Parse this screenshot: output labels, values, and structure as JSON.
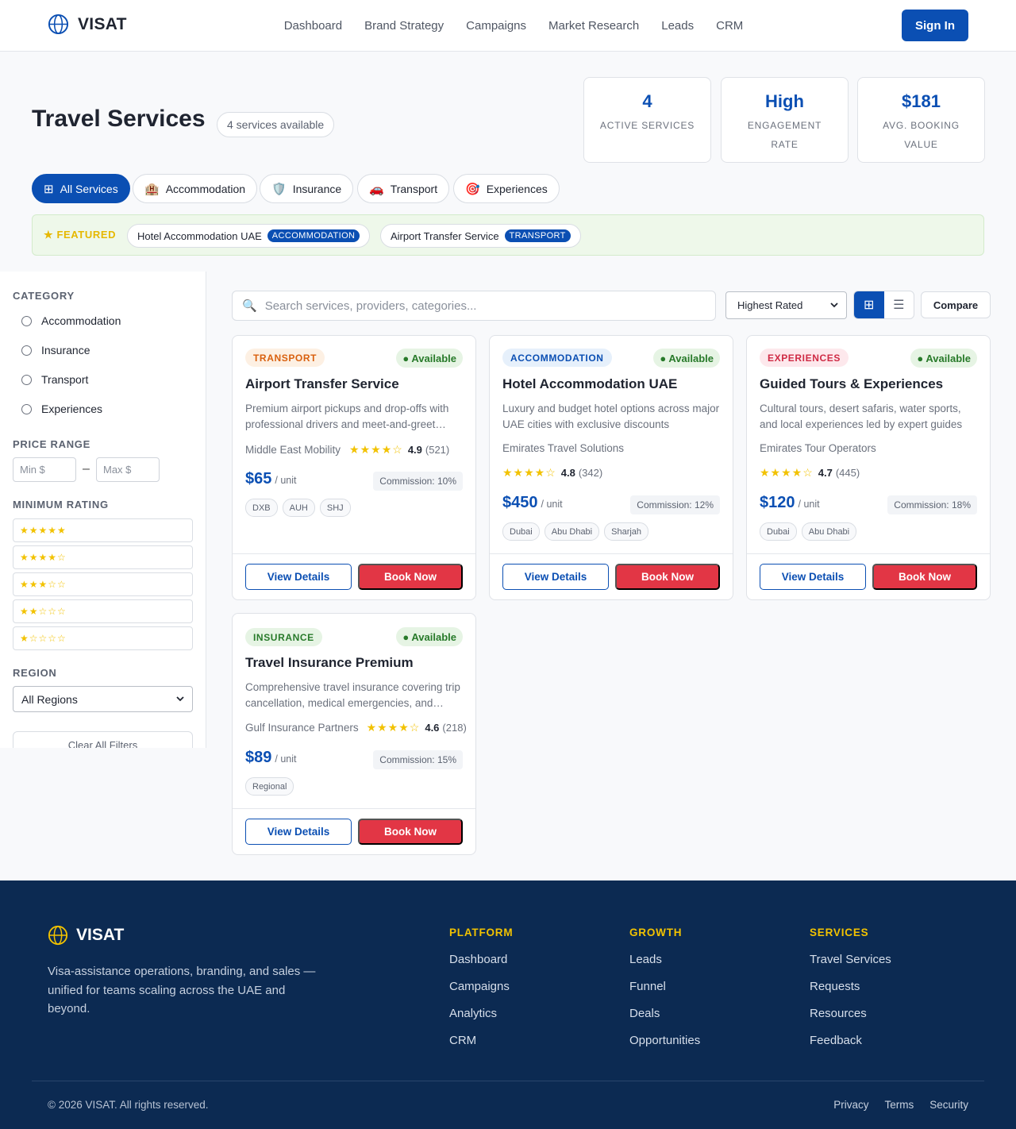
{
  "nav": {
    "brand": "VISAT",
    "links": [
      "Dashboard",
      "Brand Strategy",
      "Campaigns",
      "Market Research",
      "Leads",
      "CRM"
    ],
    "sign_in": "Sign In"
  },
  "header": {
    "title": "Travel Services",
    "count": "4 services available",
    "stats": [
      {
        "value": "4",
        "label": "ACTIVE SERVICES"
      },
      {
        "value": "High",
        "label": "ENGAGEMENT RATE"
      },
      {
        "value": "$181",
        "label": "AVG. BOOKING VALUE"
      }
    ]
  },
  "tabs": [
    {
      "icon": "grid-icon",
      "glyph": "⊞",
      "label": "All Services",
      "active": true
    },
    {
      "icon": "hotel-icon",
      "glyph": "🏨",
      "label": "Accommodation"
    },
    {
      "icon": "shield-icon",
      "glyph": "🛡️",
      "label": "Insurance"
    },
    {
      "icon": "car-icon",
      "glyph": "🚗",
      "label": "Transport"
    },
    {
      "icon": "target-icon",
      "glyph": "🎯",
      "label": "Experiences"
    }
  ],
  "featured": {
    "label": "★ FEATURED",
    "items": [
      {
        "name": "Hotel Accommodation UAE",
        "tag": "ACCOMMODATION"
      },
      {
        "name": "Airport Transfer Service",
        "tag": "TRANSPORT"
      }
    ]
  },
  "sidebar": {
    "category_heading": "CATEGORY",
    "categories": [
      "Accommodation",
      "Insurance",
      "Transport",
      "Experiences"
    ],
    "price_heading": "PRICE RANGE",
    "min_placeholder": "Min $",
    "max_placeholder": "Max $",
    "price_sep": "–",
    "rating_heading": "MINIMUM RATING",
    "ratings": [
      "★★★★★",
      "★★★★☆",
      "★★★☆☆",
      "★★☆☆☆",
      "★☆☆☆☆"
    ],
    "region_heading": "REGION",
    "region_value": "All Regions",
    "clear_label": "Clear All Filters"
  },
  "toolbar": {
    "search_placeholder": "Search services, providers, categories...",
    "sort_value": "Highest Rated",
    "grid_glyph": "⊞",
    "list_glyph": "☰",
    "compare": "Compare"
  },
  "cards": [
    {
      "category": "TRANSPORT",
      "cat_bg": "#fdf0e3",
      "cat_fg": "#d9600e",
      "status": "● Available",
      "title": "Airport Transfer Service",
      "desc": "Premium airport pickups and drop-offs with professional drivers and meet-and-greet…",
      "provider": "Middle East Mobility",
      "stars": "★★★★☆",
      "rating": "4.9",
      "reviews": "(521)",
      "price": "$65",
      "unit": "/ unit",
      "commission": "Commission: 10%",
      "tags": [
        "DXB",
        "AUH",
        "SHJ"
      ],
      "view": "View Details",
      "book": "Book Now"
    },
    {
      "category": "ACCOMMODATION",
      "cat_bg": "#e6f0fb",
      "cat_fg": "#0b4fb3",
      "status": "● Available",
      "title": "Hotel Accommodation UAE",
      "desc": "Luxury and budget hotel options across major UAE cities with exclusive discounts",
      "provider": "Emirates Travel Solutions",
      "stars": "★★★★☆",
      "rating": "4.8",
      "reviews": "(342)",
      "price": "$450",
      "unit": "/ unit",
      "commission": "Commission: 12%",
      "tags": [
        "Dubai",
        "Abu Dhabi",
        "Sharjah"
      ],
      "view": "View Details",
      "book": "Book Now"
    },
    {
      "category": "EXPERIENCES",
      "cat_bg": "#fde8ec",
      "cat_fg": "#cf2a44",
      "status": "● Available",
      "title": "Guided Tours & Experiences",
      "desc": "Cultural tours, desert safaris, water sports, and local experiences led by expert guides",
      "provider": "Emirates Tour Operators",
      "stars": "★★★★☆",
      "rating": "4.7",
      "reviews": "(445)",
      "price": "$120",
      "unit": "/ unit",
      "commission": "Commission: 18%",
      "tags": [
        "Dubai",
        "Abu Dhabi"
      ],
      "view": "View Details",
      "book": "Book Now"
    },
    {
      "category": "INSURANCE",
      "cat_bg": "#e6f4e4",
      "cat_fg": "#287a2a",
      "status": "● Available",
      "title": "Travel Insurance Premium",
      "desc": "Comprehensive travel insurance covering trip cancellation, medical emergencies, and…",
      "provider": "Gulf Insurance Partners",
      "stars": "★★★★☆",
      "rating": "4.6",
      "reviews": "(218)",
      "price": "$89",
      "unit": "/ unit",
      "commission": "Commission: 15%",
      "tags": [
        "Regional"
      ],
      "view": "View Details",
      "book": "Book Now"
    }
  ],
  "footer": {
    "brand": "VISAT",
    "tagline": "Visa-assistance operations, branding, and sales — unified for teams scaling across the UAE and beyond.",
    "columns": [
      {
        "heading": "PLATFORM",
        "links": [
          "Dashboard",
          "Campaigns",
          "Analytics",
          "CRM"
        ]
      },
      {
        "heading": "GROWTH",
        "links": [
          "Leads",
          "Funnel",
          "Deals",
          "Opportunities"
        ]
      },
      {
        "heading": "SERVICES",
        "links": [
          "Travel Services",
          "Requests",
          "Resources",
          "Feedback"
        ]
      }
    ],
    "copyright": "© 2026 VISAT. All rights reserved.",
    "legal": [
      "Privacy",
      "Terms",
      "Security"
    ]
  }
}
